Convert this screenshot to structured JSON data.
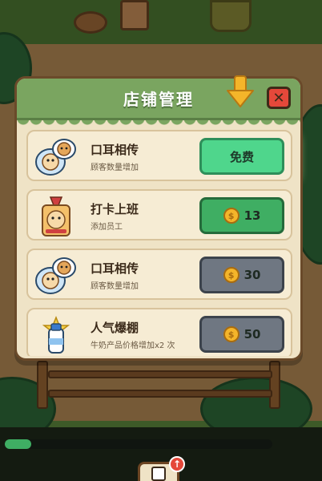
{
  "game": {
    "progress": 0.1,
    "clipboard_badge": "↑"
  },
  "modal": {
    "title": "店铺管理",
    "close_symbol": "✕",
    "items": [
      {
        "name": "口耳相传",
        "desc": "顾客数量增加",
        "icon": "hamster-speech-icon",
        "button": {
          "type": "free",
          "label": "免费"
        }
      },
      {
        "name": "打卡上班",
        "desc": "添加员工",
        "icon": "hamster-badge-icon",
        "button": {
          "type": "coin",
          "price": "13",
          "color": "green"
        }
      },
      {
        "name": "口耳相传",
        "desc": "顾客数量增加",
        "icon": "hamster-speech-icon",
        "button": {
          "type": "coin",
          "price": "30",
          "color": "gray"
        }
      },
      {
        "name": "人气爆棚",
        "desc": "牛奶产品价格增加x2 次",
        "icon": "milk-bottle-icon",
        "button": {
          "type": "coin",
          "price": "50",
          "color": "gray"
        }
      }
    ]
  },
  "colors": {
    "header_green": "#7aa560",
    "close_red": "#e5483a",
    "free_green": "#4fd68c",
    "buy_green": "#3fae63",
    "locked_gray": "#6f7782",
    "coin_gold": "#f4b52a"
  }
}
